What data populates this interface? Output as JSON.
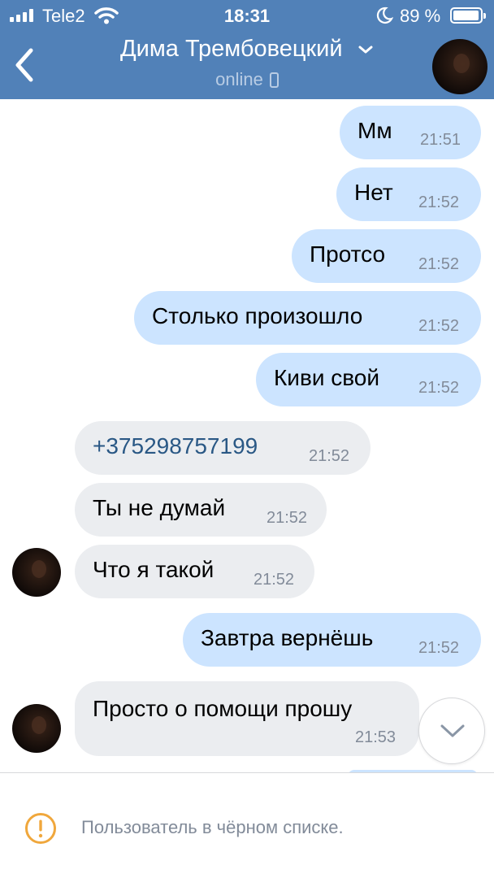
{
  "status_bar": {
    "carrier": "Tele2",
    "time": "18:31",
    "battery": "89 %"
  },
  "header": {
    "title": "Дима Трембовецкий",
    "subtitle": "online"
  },
  "messages": [
    {
      "dir": "out",
      "text": "Мм",
      "time": "21:51"
    },
    {
      "dir": "out",
      "text": "Нет",
      "time": "21:52"
    },
    {
      "dir": "out",
      "text": "Протсо",
      "time": "21:52"
    },
    {
      "dir": "out",
      "text": "Столько произошло",
      "time": "21:52"
    },
    {
      "dir": "out",
      "text": "Киви свой",
      "time": "21:52"
    },
    {
      "dir": "in",
      "text": "+375298757199",
      "time": "21:52"
    },
    {
      "dir": "in",
      "text": "Ты не думай",
      "time": "21:52"
    },
    {
      "dir": "in",
      "text": "Что я такой",
      "time": "21:52"
    },
    {
      "dir": "out",
      "text": "Завтра вернёшь",
      "time": "21:52"
    },
    {
      "dir": "in",
      "text": "Просто о помощи прошу",
      "time": "21:53"
    }
  ],
  "footer": {
    "notice": "Пользователь в чёрном списке."
  },
  "colors": {
    "header": "#5181b8",
    "outgoing": "#cce4ff",
    "incoming": "#ebedf0",
    "link": "#2a5885",
    "warning": "#f0a73c"
  },
  "icons": [
    "signal-icon",
    "wifi-icon",
    "moon-icon",
    "battery-icon",
    "back-chevron-icon",
    "title-chevron-down-icon",
    "phone-icon",
    "chevron-down-icon",
    "warning-icon"
  ]
}
